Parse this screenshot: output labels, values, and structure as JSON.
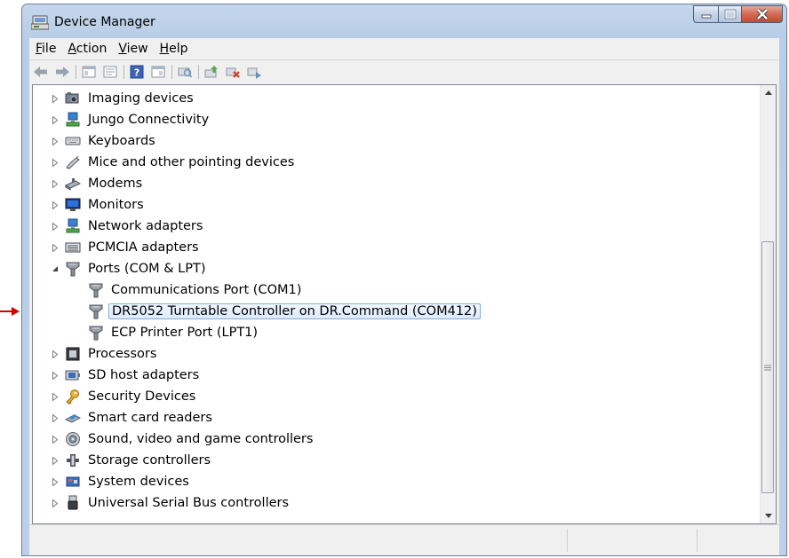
{
  "window": {
    "title": "Device Manager"
  },
  "menu": [
    {
      "mn": "F",
      "rest": "ile"
    },
    {
      "mn": "A",
      "rest": "ction"
    },
    {
      "mn": "V",
      "rest": "iew"
    },
    {
      "mn": "H",
      "rest": "elp"
    }
  ],
  "toolbar": [
    "back-icon",
    "forward-icon",
    "separator",
    "show-hide-console-tree-icon",
    "properties-icon",
    "separator",
    "help-icon",
    "show-action-pane-icon",
    "separator",
    "scan-hardware-icon",
    "separator",
    "update-driver-icon",
    "uninstall-icon",
    "disable-icon"
  ],
  "tree": {
    "items": [
      {
        "label": "Imaging devices",
        "icon": "camera-icon",
        "level": 0,
        "expander": "collapsed"
      },
      {
        "label": "Jungo Connectivity",
        "icon": "network-device-icon",
        "level": 0,
        "expander": "collapsed"
      },
      {
        "label": "Keyboards",
        "icon": "keyboard-icon",
        "level": 0,
        "expander": "collapsed"
      },
      {
        "label": "Mice and other pointing devices",
        "icon": "mouse-icon",
        "level": 0,
        "expander": "collapsed"
      },
      {
        "label": "Modems",
        "icon": "modem-icon",
        "level": 0,
        "expander": "collapsed"
      },
      {
        "label": "Monitors",
        "icon": "monitor-icon",
        "level": 0,
        "expander": "collapsed"
      },
      {
        "label": "Network adapters",
        "icon": "network-adapter-icon",
        "level": 0,
        "expander": "collapsed"
      },
      {
        "label": "PCMCIA adapters",
        "icon": "pcmcia-icon",
        "level": 0,
        "expander": "collapsed"
      },
      {
        "label": "Ports (COM & LPT)",
        "icon": "port-icon",
        "level": 0,
        "expander": "expanded"
      },
      {
        "label": "Communications Port (COM1)",
        "icon": "port-icon",
        "level": 1,
        "expander": "none"
      },
      {
        "label": "DR5052 Turntable Controller on DR.Command (COM412)",
        "icon": "port-icon",
        "level": 1,
        "expander": "none",
        "selected": true
      },
      {
        "label": "ECP Printer Port (LPT1)",
        "icon": "port-icon",
        "level": 1,
        "expander": "none"
      },
      {
        "label": "Processors",
        "icon": "processor-icon",
        "level": 0,
        "expander": "collapsed"
      },
      {
        "label": "SD host adapters",
        "icon": "sd-adapter-icon",
        "level": 0,
        "expander": "collapsed"
      },
      {
        "label": "Security Devices",
        "icon": "security-key-icon",
        "level": 0,
        "expander": "collapsed"
      },
      {
        "label": "Smart card readers",
        "icon": "smart-card-icon",
        "level": 0,
        "expander": "collapsed"
      },
      {
        "label": "Sound, video and game controllers",
        "icon": "speaker-icon",
        "level": 0,
        "expander": "collapsed"
      },
      {
        "label": "Storage controllers",
        "icon": "storage-controller-icon",
        "level": 0,
        "expander": "collapsed"
      },
      {
        "label": "System devices",
        "icon": "system-device-icon",
        "level": 0,
        "expander": "collapsed"
      },
      {
        "label": "Universal Serial Bus controllers",
        "icon": "usb-icon",
        "level": 0,
        "expander": "collapsed"
      }
    ]
  },
  "colors": {
    "selection_border": "#84acdd",
    "selection_fill": "#dbeafd",
    "close_button": "#c24a32",
    "annotation_arrow": "#d40000"
  }
}
